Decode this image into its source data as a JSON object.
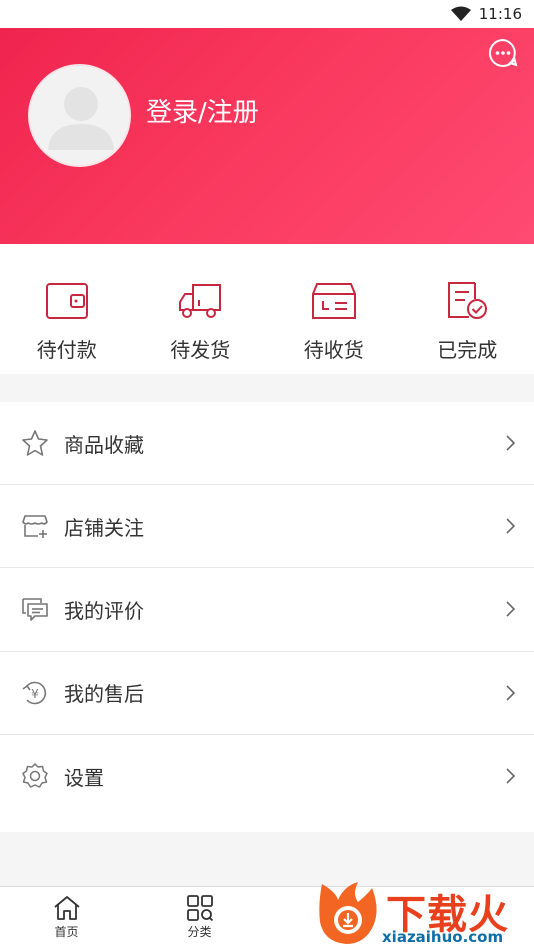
{
  "status_bar": {
    "time": "11:16"
  },
  "header": {
    "login_label": "登录/注册"
  },
  "orders": [
    {
      "label": "待付款",
      "icon": "wallet-icon"
    },
    {
      "label": "待发货",
      "icon": "truck-icon"
    },
    {
      "label": "待收货",
      "icon": "box-icon"
    },
    {
      "label": "已完成",
      "icon": "completed-doc-icon"
    }
  ],
  "menu": [
    {
      "label": "商品收藏",
      "icon": "star-icon"
    },
    {
      "label": "店铺关注",
      "icon": "shop-follow-icon"
    },
    {
      "label": "我的评价",
      "icon": "comment-icon"
    },
    {
      "label": "我的售后",
      "icon": "after-sale-icon"
    },
    {
      "label": "设置",
      "icon": "gear-icon"
    }
  ],
  "tabbar": [
    {
      "label": "首页",
      "icon": "home-icon"
    },
    {
      "label": "分类",
      "icon": "category-icon"
    }
  ],
  "watermark": {
    "brand": "下载火",
    "url": "xiazaihuo.com"
  },
  "colors": {
    "accent": "#f7325a",
    "icon_stroke": "#c8283f"
  }
}
